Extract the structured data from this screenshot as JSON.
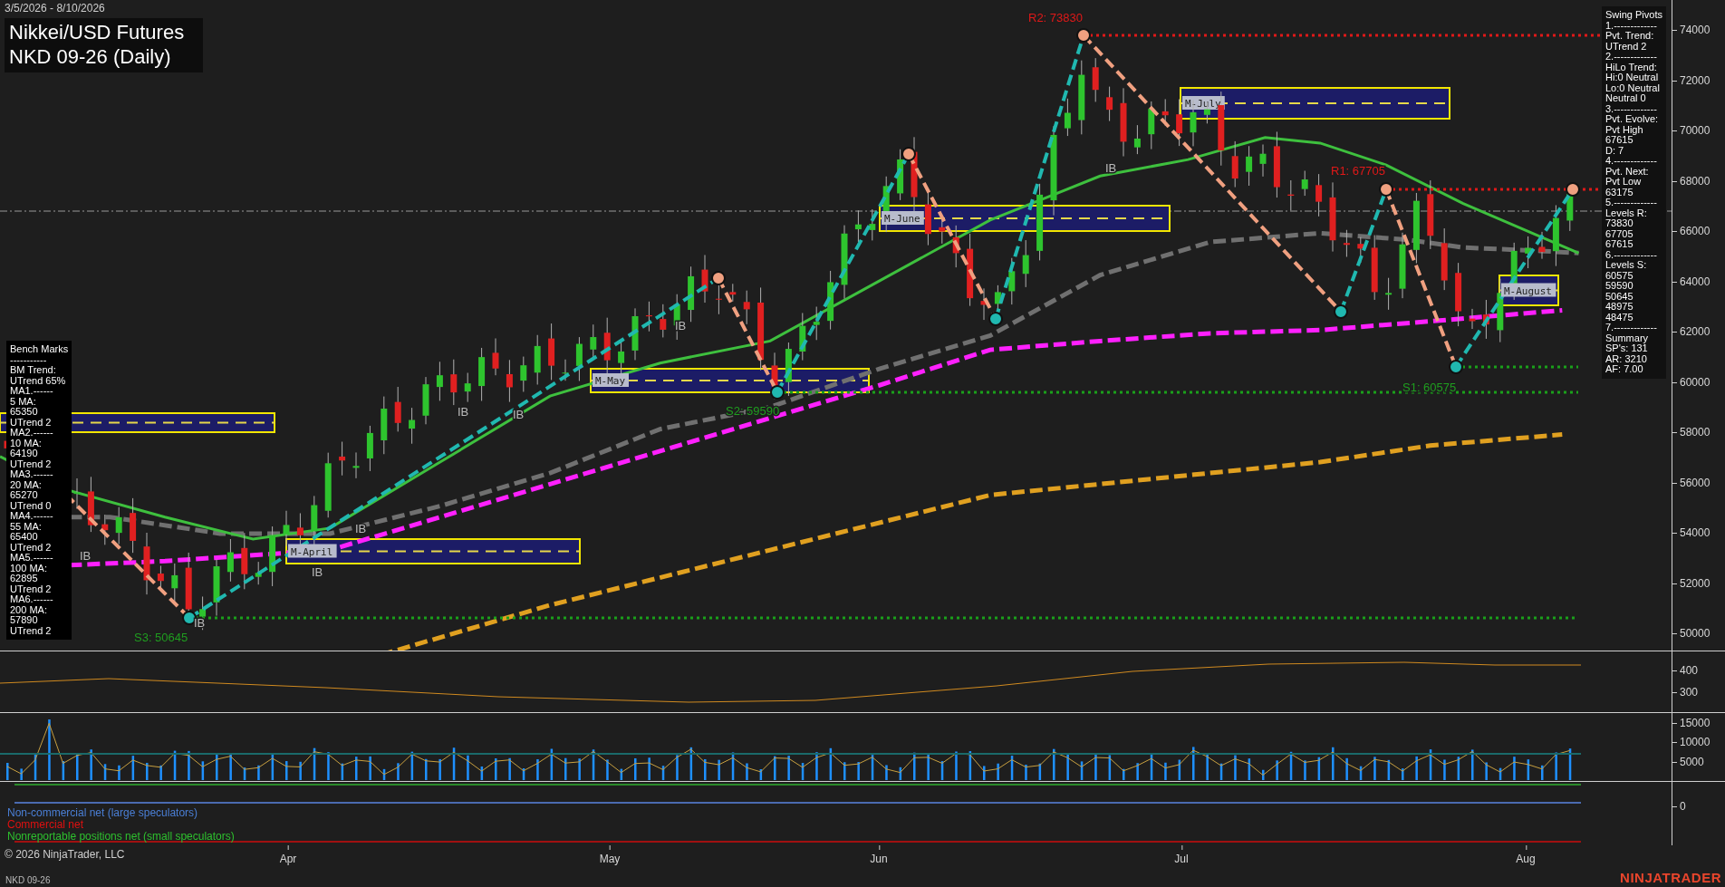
{
  "header": {
    "date_range": "3/5/2026 - 8/10/2026",
    "title": "Nikkei/USD Futures",
    "subtitle": "NKD 09-26 (Daily)"
  },
  "swing_pivots": [
    "Swing Pivots",
    "1.-------------",
    "Pvt. Trend:",
    "UTrend 2",
    "2.-------------",
    "HiLo Trend:",
    "Hi:0 Neutral",
    "Lo:0 Neutral",
    "Neutral 0",
    "3.-------------",
    "Pvt. Evolve:",
    "Pvt High",
    "67615",
    "D: 7",
    "4.-------------",
    "Pvt. Next:",
    "Pvt Low",
    "63175",
    "5.-------------",
    "Levels R:",
    "73830",
    "67705",
    "67615",
    "6.-------------",
    "Levels S:",
    "60575",
    "59590",
    "50645",
    "48975",
    "48475",
    "7.-------------",
    "Summary",
    "SP's: 131",
    "AR: 3210",
    "AF: 7.00"
  ],
  "bench_marks": [
    "Bench Marks",
    "-----------",
    "BM Trend:",
    "UTrend 65%",
    "MA1.------",
    "5 MA:",
    "65350",
    "UTrend 2",
    "MA2.------",
    "10 MA:",
    "64190",
    "UTrend 2",
    "MA3.------",
    "20 MA:",
    "65270",
    "UTrend 0",
    "MA4.------",
    "55 MA:",
    "65400",
    "UTrend 2",
    "MA5.------",
    "100 MA:",
    "62895",
    "UTrend 2",
    "MA6.------",
    "200 MA:",
    "57890",
    "UTrend 2"
  ],
  "price_chart": {
    "y_ticks": [
      "74000",
      "72000",
      "70000",
      "68000",
      "66000",
      "64000",
      "62000",
      "60000",
      "58000",
      "56000",
      "54000",
      "52000",
      "50000"
    ],
    "pivot_labels": [
      {
        "text": "R2: 73830",
        "kind": "resistance"
      },
      {
        "text": "R1: 67705",
        "kind": "resistance"
      },
      {
        "text": "S2: 59590",
        "kind": "support"
      },
      {
        "text": "S1: 60575",
        "kind": "support"
      },
      {
        "text": "S3: 50645",
        "kind": "support"
      }
    ],
    "month_boxes": [
      "M-April",
      "M-May",
      "M-June",
      "M-July",
      "M-August"
    ],
    "inside_bar_marks": [
      "IB",
      "IB",
      "IB",
      "IB",
      "IB",
      "IB",
      "IB",
      "IB"
    ]
  },
  "oscillator_panel": {
    "y_ticks": [
      "400",
      "300"
    ]
  },
  "volume_panel": {
    "y_ticks": [
      "15000",
      "10000",
      "5000"
    ]
  },
  "cot_panel": {
    "y_ticks": [
      "0"
    ],
    "legend": [
      {
        "text": "Non-commercial net (large speculators)",
        "color": "#4a7fd6"
      },
      {
        "text": "Commercial net",
        "color": "#e01010"
      },
      {
        "text": "Nonreportable positions net (small speculators)",
        "color": "#2ec02e"
      }
    ]
  },
  "copyright": "© 2026 NinjaTrader, LLC",
  "x_axis": [
    "Apr",
    "May",
    "Jun",
    "Jul",
    "Aug"
  ],
  "footer": {
    "instrument": "NKD 09-26",
    "logo": "NINJATRADER"
  }
}
